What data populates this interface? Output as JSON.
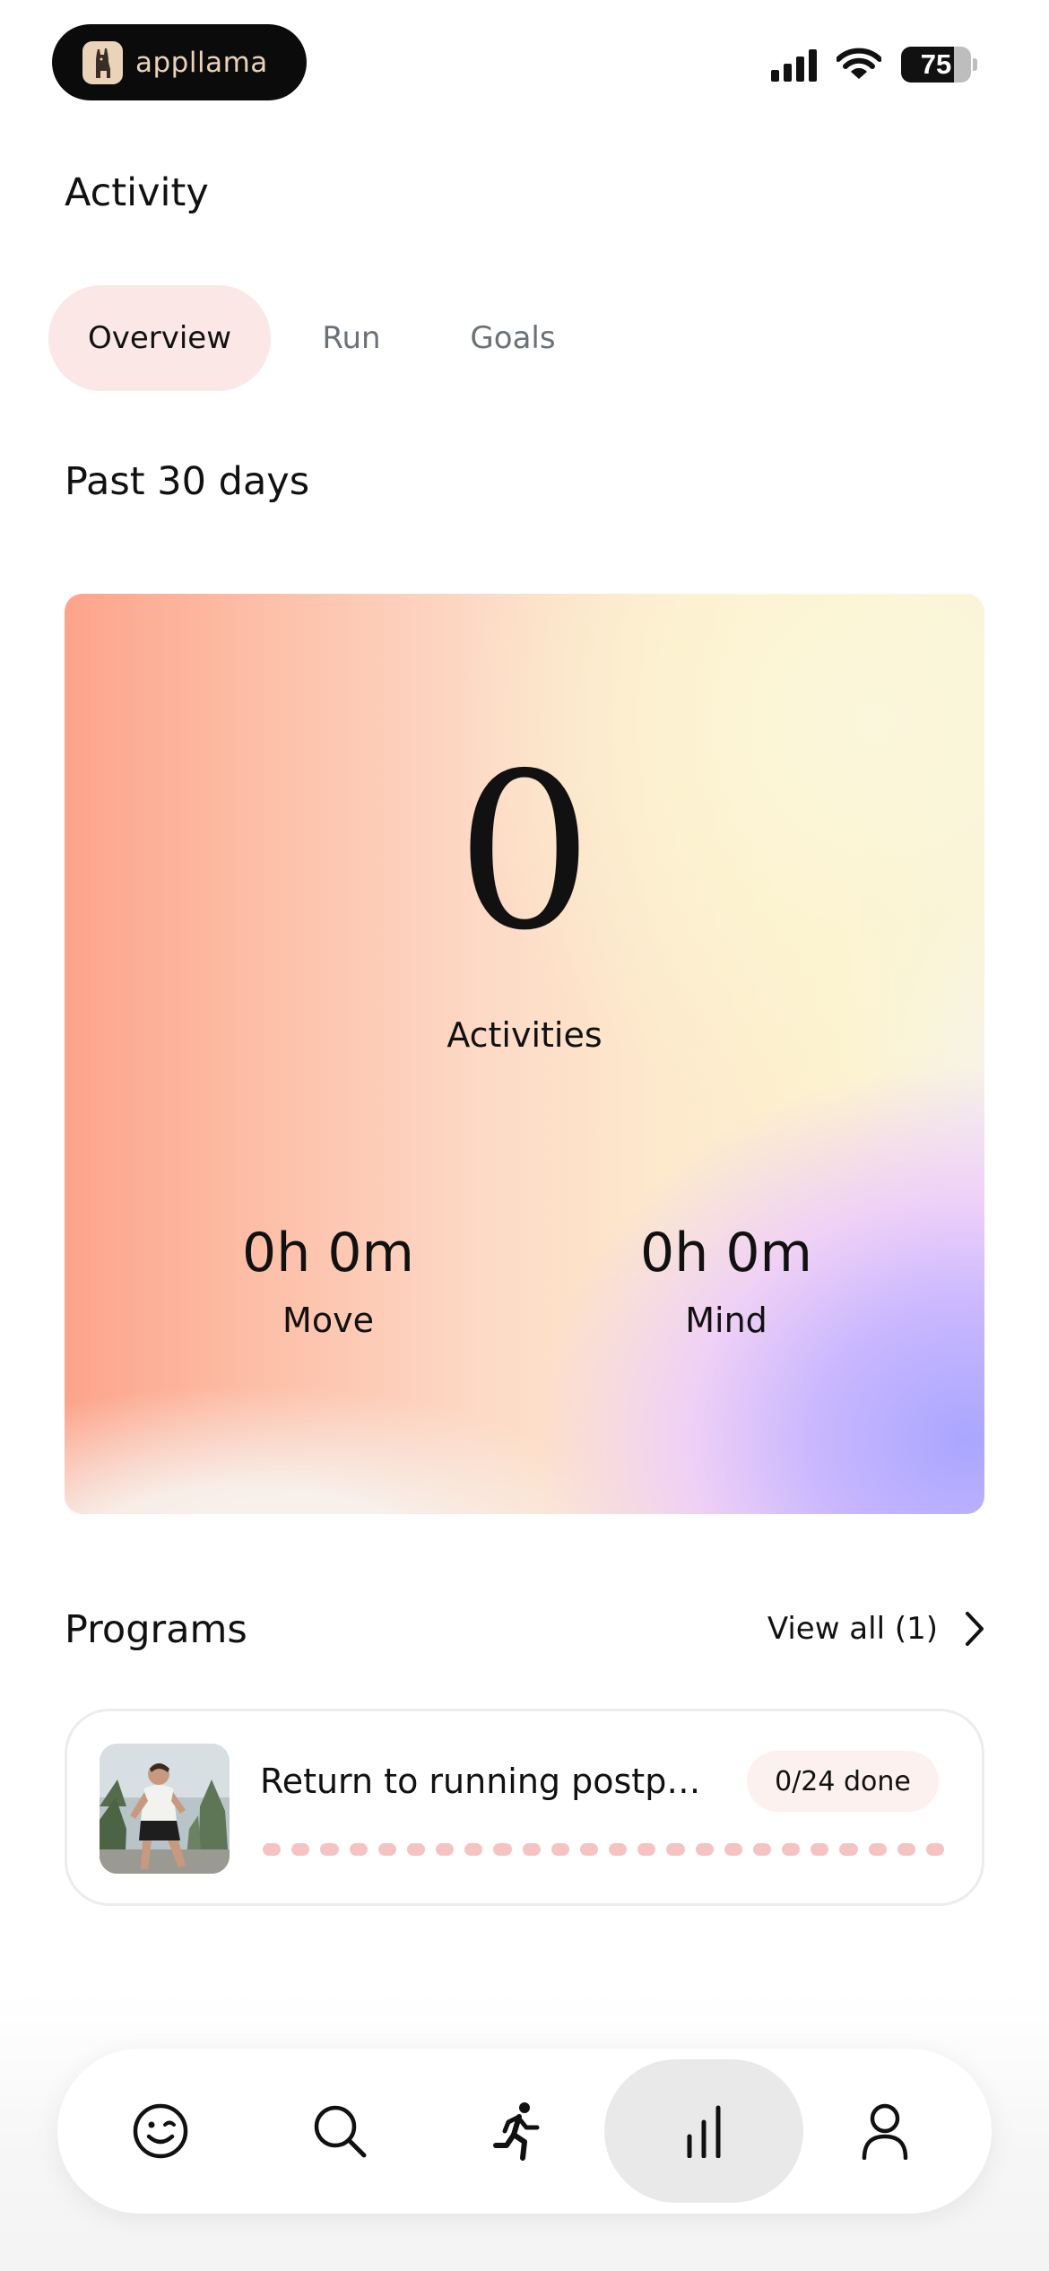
{
  "status_bar": {
    "app_name": "appllama",
    "battery_level": "75",
    "icons": [
      "llama-logo-icon",
      "cellular-signal-icon",
      "wifi-icon",
      "battery-icon"
    ]
  },
  "header": {
    "title": "Activity"
  },
  "tabs": [
    {
      "label": "Overview",
      "active": true
    },
    {
      "label": "Run",
      "active": false
    },
    {
      "label": "Goals",
      "active": false
    }
  ],
  "summary": {
    "period_label": "Past 30 days",
    "activities_count": "0",
    "activities_label": "Activities",
    "move_value": "0h 0m",
    "move_label": "Move",
    "mind_value": "0h 0m",
    "mind_label": "Mind"
  },
  "programs": {
    "title": "Programs",
    "view_all_label": "View all (1)",
    "items": [
      {
        "title": "Return to running postpar...",
        "status": "0/24 done",
        "completed_sessions": 0,
        "total_sessions": 24
      }
    ]
  },
  "bottom_nav": {
    "items": [
      {
        "icon": "smiley-face-icon",
        "active": false
      },
      {
        "icon": "search-icon",
        "active": false
      },
      {
        "icon": "running-person-icon",
        "active": false
      },
      {
        "icon": "bar-chart-icon",
        "active": true
      },
      {
        "icon": "profile-icon",
        "active": false
      }
    ]
  },
  "colors": {
    "active_tab_bg": "#fbe8e6",
    "progress_segment": "#f6c3c3",
    "badge_bg": "#fdf1ef",
    "nav_active_bg": "#e9e9e9"
  }
}
